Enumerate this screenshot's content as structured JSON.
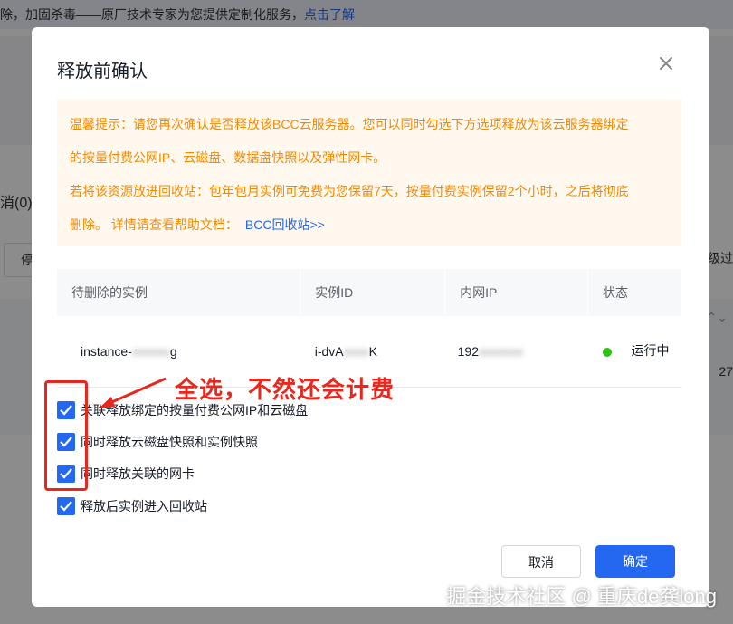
{
  "background": {
    "top_notice": "除，加固杀毒——原厂技术专家为您提供定制化服务，",
    "top_notice_link": "点击了解",
    "tab_fragment": "消(0)",
    "button_fragment": "停",
    "advanced_fragment": "高级过",
    "number_fragment": "27",
    "chevron": "⌃⌄"
  },
  "modal": {
    "title": "释放前确认",
    "tip": {
      "line1": "温馨提示：请您再次确认是否释放该BCC云服务器。您可以同时勾选下方选项释放为该云服务器绑定",
      "line2": "的按量付费公网IP、云磁盘、数据盘快照以及弹性网卡。",
      "line3": "若将该资源放进回收站：包年包月实例可免费为您保留7天，按量付费实例保留2个小时，之后将彻底",
      "line4": "删除。 详情请查看帮助文档：",
      "doc_link": "BCC回收站>>"
    },
    "table": {
      "headers": [
        "待删除的实例",
        "实例ID",
        "内网IP",
        "状态"
      ],
      "row": {
        "name": "instance-",
        "name_blur": "xxxxxx",
        "name_tail": "g",
        "id": "i-dvA",
        "id_blur": "xxxx",
        "id_tail": "K",
        "ip": "192",
        "ip_blur": "xxxxxxx",
        "status": "运行中"
      }
    },
    "options": [
      "关联释放绑定的按量付费公网IP和云磁盘",
      "同时释放云磁盘快照和实例快照",
      "同时释放关联的网卡",
      "释放后实例进入回收站"
    ],
    "cancel_label": "取消",
    "ok_label": "确定"
  },
  "annotation": {
    "text": "全选，不然还会计费",
    "color": "#e8281e"
  },
  "watermark": "掘金技术社区 @ 重庆de龚long",
  "colors": {
    "primary": "#2468f2",
    "tip_text": "#f38900",
    "status_green": "#30bf13"
  }
}
